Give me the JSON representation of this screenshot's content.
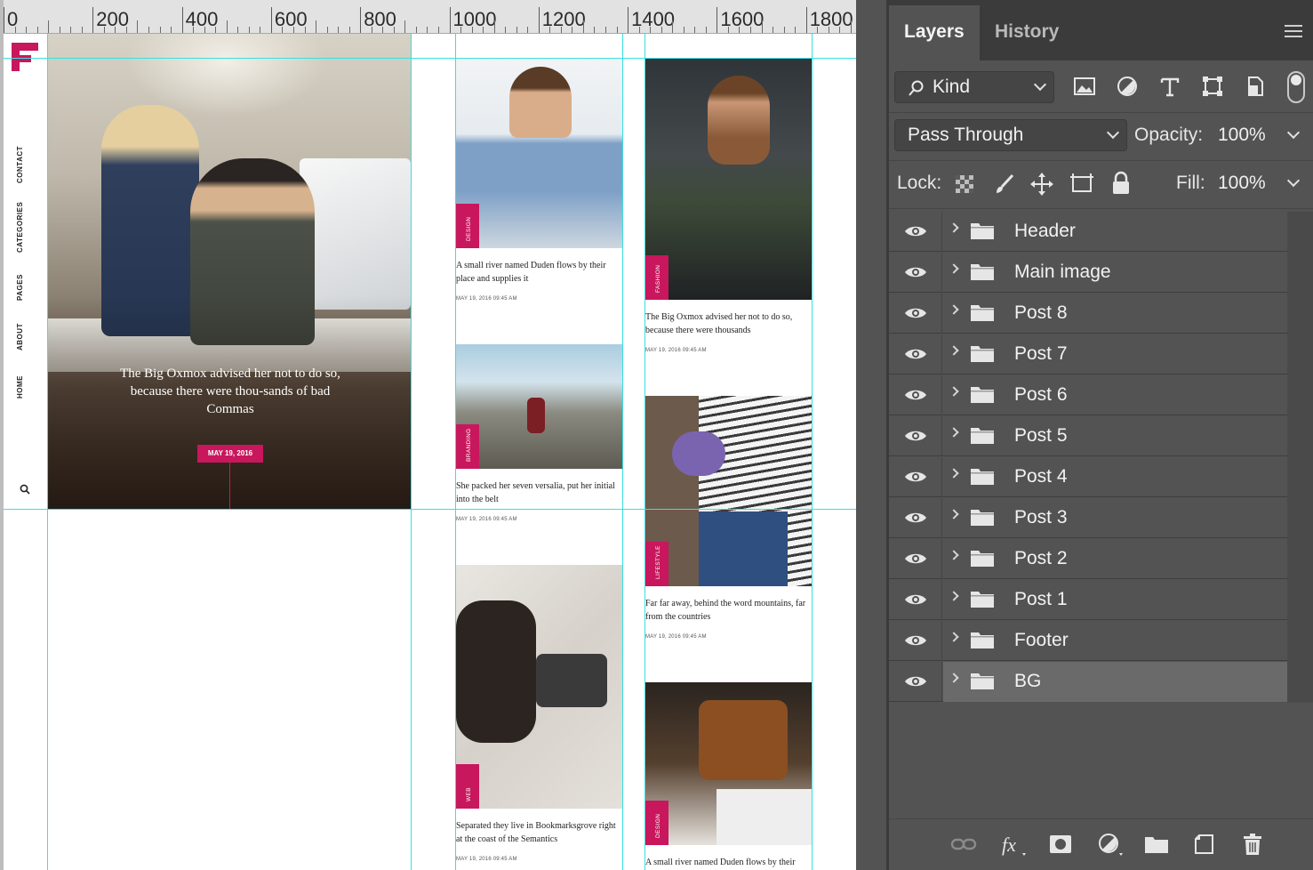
{
  "ruler": {
    "labels": [
      "0",
      "200",
      "400",
      "600",
      "800",
      "1000",
      "1200",
      "1400",
      "1600",
      "1800"
    ]
  },
  "design": {
    "brand_color": "#c8175d",
    "logo": "f-logo-icon",
    "nav": [
      "CONTACT",
      "CATEGORIES",
      "PAGES",
      "ABOUT",
      "HOME"
    ],
    "search_icon": "search-icon",
    "hero": {
      "caption": "The Big Oxmox advised her not to do so, because there were thou-sands of bad Commas",
      "date": "MAY 19, 2016"
    },
    "posts": [
      {
        "tag": "DESIGN",
        "title": "A small river named Duden flows by their place and supplies it",
        "date": "MAY 19, 2016 09:45 AM"
      },
      {
        "tag": "BRANDING",
        "title": "She packed her seven versalia, put her initial into the belt",
        "date": "MAY 19, 2016 09:45 AM"
      },
      {
        "tag": "WEB",
        "title": "Separated they live in Bookmarksgrove right at the coast of the Semantics",
        "date": "MAY 19, 2016 09:45 AM"
      },
      {
        "tag": "FASHION",
        "title": "The Big Oxmox advised her not to do so, because there were thousands",
        "date": "MAY 19, 2016 09:45 AM"
      },
      {
        "tag": "LIFESTYLE",
        "title": "Far far away, behind the word mountains, far from the countries",
        "date": "MAY 19, 2016 09:45 AM"
      },
      {
        "tag": "DESIGN",
        "title": "A small river named Duden flows by their",
        "date": ""
      }
    ]
  },
  "panel": {
    "tabs": [
      "Layers",
      "History"
    ],
    "filter": {
      "kind_label": "Kind",
      "icons": [
        "image-filter-icon",
        "adjustment-filter-icon",
        "type-filter-icon",
        "shape-filter-icon",
        "smart-object-filter-icon"
      ]
    },
    "blend_mode": "Pass Through",
    "opacity_label": "Opacity:",
    "opacity_value": "100%",
    "lock_label": "Lock:",
    "fill_label": "Fill:",
    "fill_value": "100%",
    "layers": [
      {
        "name": "Header"
      },
      {
        "name": "Main image"
      },
      {
        "name": "Post 8"
      },
      {
        "name": "Post 7"
      },
      {
        "name": "Post 6"
      },
      {
        "name": "Post 5"
      },
      {
        "name": "Post 4"
      },
      {
        "name": "Post 3"
      },
      {
        "name": "Post 2"
      },
      {
        "name": "Post 1"
      },
      {
        "name": "Footer"
      },
      {
        "name": "BG",
        "selected": true
      }
    ],
    "bottom_icons": [
      "link-layers-icon",
      "fx-icon",
      "add-mask-icon",
      "adjustment-layer-icon",
      "new-group-icon",
      "new-layer-icon",
      "delete-icon"
    ]
  }
}
